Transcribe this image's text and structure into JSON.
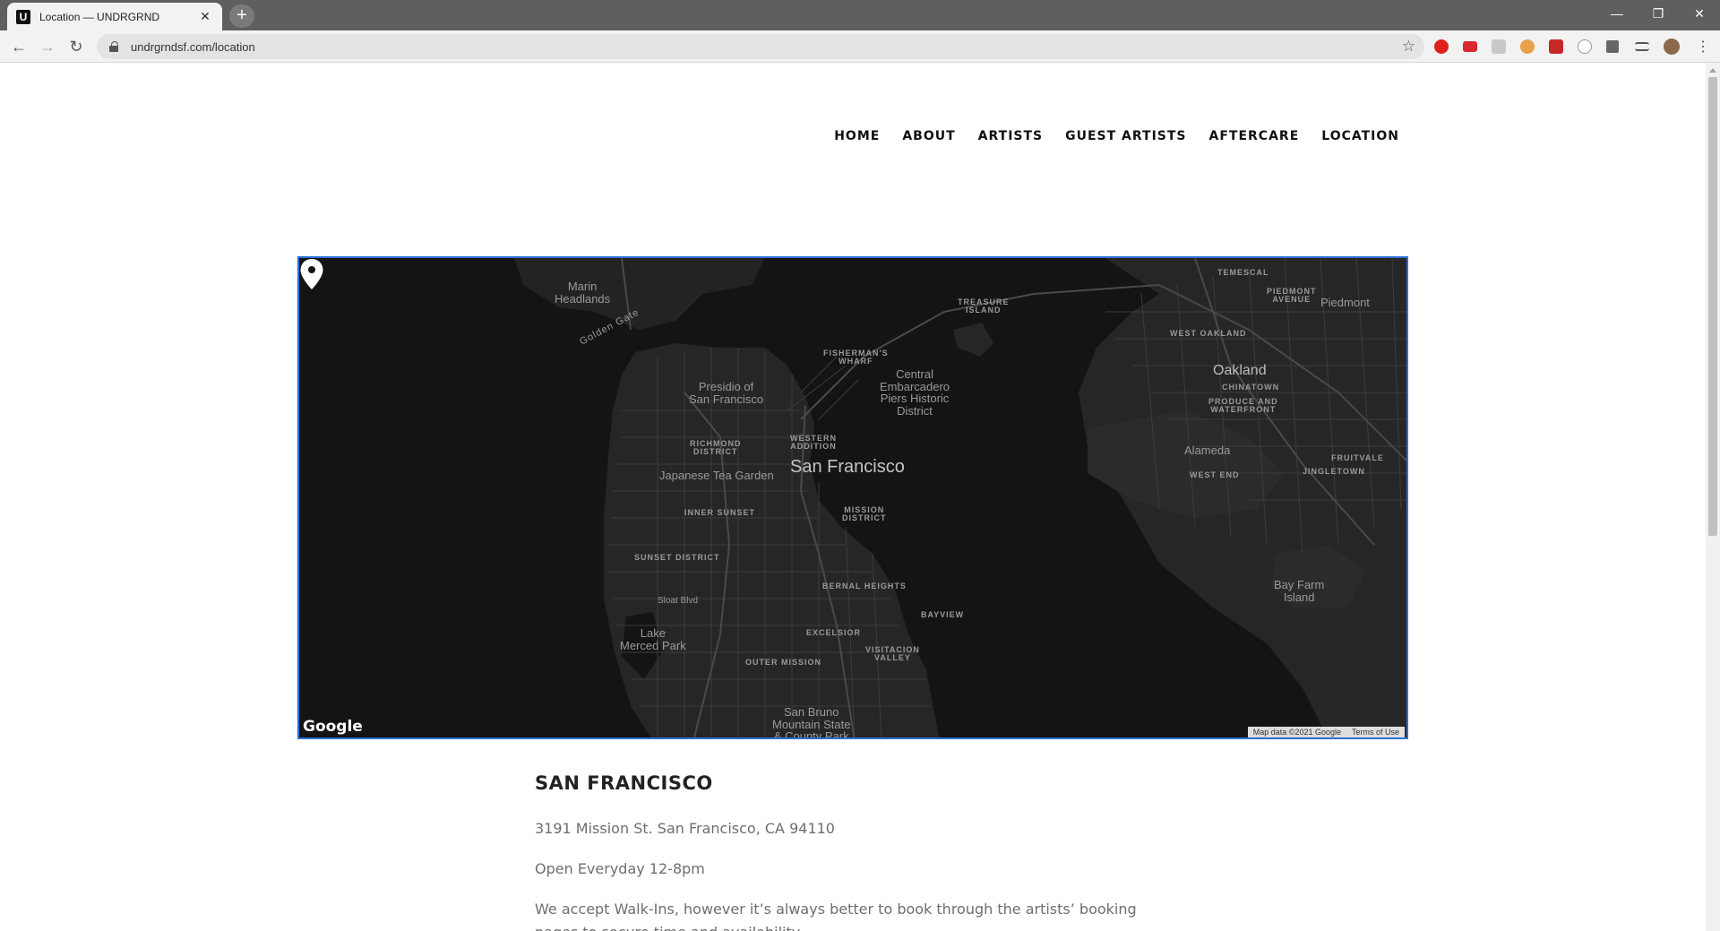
{
  "browser": {
    "tab_title": "Location — UNDRGRND",
    "favicon_letter": "U",
    "url": "undrgrndsf.com/location",
    "new_tab": "+",
    "tab_close": "✕"
  },
  "nav": {
    "items": [
      "HOME",
      "ABOUT",
      "ARTISTS",
      "GUEST ARTISTS",
      "AFTERCARE",
      "LOCATION"
    ]
  },
  "map": {
    "labels": {
      "marin_headlands": "Marin\nHeadlands",
      "golden_gate": "Golden Gate",
      "treasure_island": "TREASURE\nISLAND",
      "temescal": "TEMESCAL",
      "piedmont_avenue": "PIEDMONT\nAVENUE",
      "piedmont": "Piedmont",
      "west_oakland": "WEST OAKLAND",
      "oakland": "Oakland",
      "chinatown": "CHINATOWN",
      "produce_waterfront": "PRODUCE AND\nWATERFRONT",
      "fishermans_wharf": "FISHERMAN'S\nWHARF",
      "central_embarcadero": "Central\nEmbarcadero\nPiers Historic\nDistrict",
      "presidio": "Presidio of\nSan Francisco",
      "richmond": "RICHMOND\nDISTRICT",
      "western_addition": "WESTERN\nADDITION",
      "japanese_tea_garden": "Japanese Tea Garden",
      "san_francisco": "San Francisco",
      "alameda": "Alameda",
      "west_end": "WEST END",
      "fruitvale": "FRUITVALE",
      "jingletown": "JINGLETOWN",
      "inner_sunset": "INNER SUNSET",
      "mission_district": "MISSION\nDISTRICT",
      "sunset_district": "SUNSET DISTRICT",
      "bernal_heights": "BERNAL HEIGHTS",
      "sloat_blvd": "Sloat Blvd",
      "bayview": "BAYVIEW",
      "bay_farm": "Bay Farm\nIsland",
      "lake_merced": "Lake\nMerced Park",
      "excelsior": "EXCELSIOR",
      "outer_mission": "OUTER MISSION",
      "visitacion_valley": "VISITACION\nVALLEY",
      "san_bruno": "San Bruno\nMountain State\n& County Park"
    },
    "google_logo": "Google",
    "attribution": "Map data ©2021 Google",
    "terms": "Terms of Use"
  },
  "location": {
    "heading": "SAN FRANCISCO",
    "address": "3191 Mission St. San Francisco, CA 94110",
    "hours": "Open Everyday 12-8pm",
    "walkins": "We accept Walk-Ins, however it’s always better to book through the artists’ booking pages to secure time and availability."
  },
  "colors": {
    "map_background": "#141414",
    "land": "#262626",
    "map_border": "#2a6fd6",
    "chrome_tabbar": "#5f5f5f"
  }
}
